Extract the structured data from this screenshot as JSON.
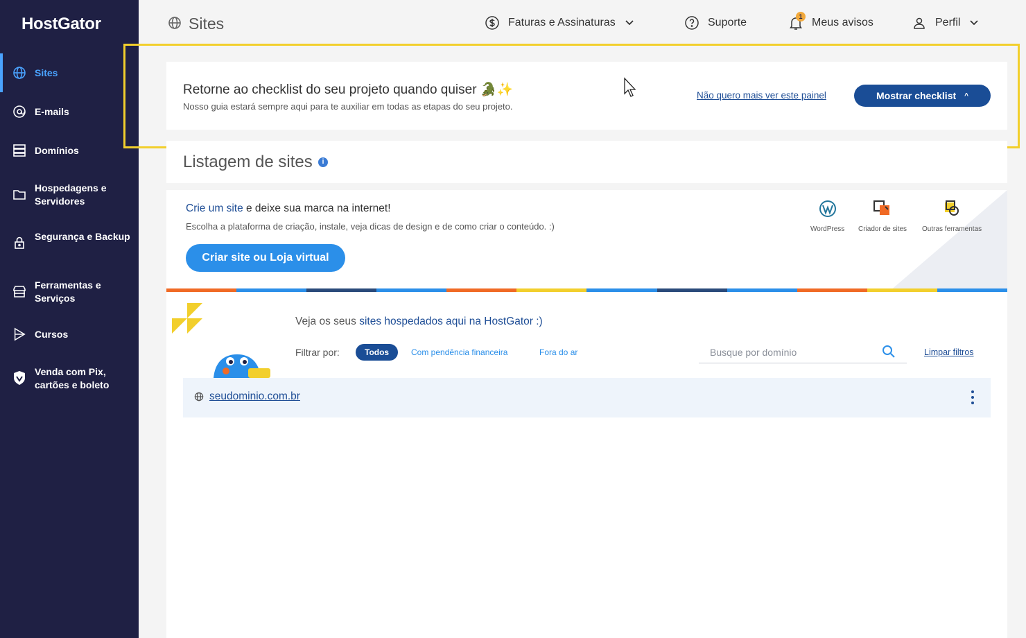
{
  "brand": {
    "logo": "HostGator",
    "colors": {
      "sidebar": "#1f2044",
      "accent": "#4aa3ff",
      "primary": "#1a4d96",
      "button": "#2b8fe9",
      "highlight": "#f2cf2c"
    }
  },
  "sidebar": {
    "items": [
      {
        "label": "Sites",
        "icon": "globe-icon",
        "active": true
      },
      {
        "label": "E-mails",
        "icon": "at-icon"
      },
      {
        "label": "Domínios",
        "icon": "server-icon"
      },
      {
        "label": "Hospedagens e Servidores",
        "icon": "folder-icon"
      },
      {
        "label": "Segurança e Backup",
        "icon": "lock-icon"
      },
      {
        "label": "Ferramentas e Serviços",
        "icon": "store-icon"
      },
      {
        "label": "Cursos",
        "icon": "play-icon"
      },
      {
        "label": "Venda com Pix, cartões e boleto",
        "icon": "shield-icon"
      }
    ]
  },
  "header": {
    "title": "Sites",
    "billing": "Faturas e Assinaturas",
    "support": "Suporte",
    "notices": "Meus avisos",
    "notices_count": "1",
    "profile": "Perfil"
  },
  "checklist_banner": {
    "title": "Retorne ao checklist do seu projeto quando quiser 🐊✨",
    "subtitle": "Nosso guia estará sempre aqui para te auxiliar em todas as etapas do seu projeto.",
    "dismiss_link": "Não quero mais ver este painel",
    "show_button": "Mostrar checklist"
  },
  "listing": {
    "title": "Listagem de sites",
    "info": "i"
  },
  "create_card": {
    "title_highlight": "Crie um site",
    "title_rest": " e deixe sua marca na internet!",
    "subtitle": "Escolha a plataforma de criação, instale, veja dicas de design e de como criar o conteúdo. :)",
    "button": "Criar site ou Loja virtual",
    "tools": [
      "WordPress",
      "Criador de sites",
      "Outras ferramentas"
    ]
  },
  "sites_panel": {
    "heading_prefix": "Veja os seus ",
    "heading_highlight": "sites hospedados aqui na HostGator :)",
    "filter_label": "Filtrar por:",
    "filters": [
      "Todos",
      "Com pendência financeira",
      "Fora do ar"
    ],
    "search_placeholder": "Busque por domínio",
    "clear_filters": "Limpar filtros",
    "rows": [
      {
        "domain": "seudominio.com.br"
      }
    ]
  }
}
